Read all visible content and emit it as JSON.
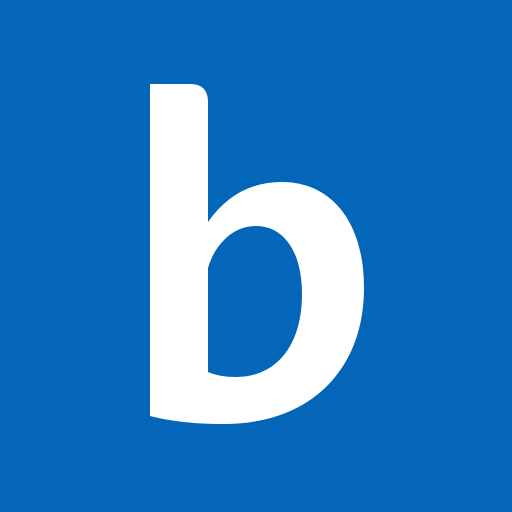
{
  "icon": {
    "name": "letter-b-logo-icon",
    "letter": "b",
    "background_color": "#0366b8",
    "foreground_color": "#ffffff"
  }
}
